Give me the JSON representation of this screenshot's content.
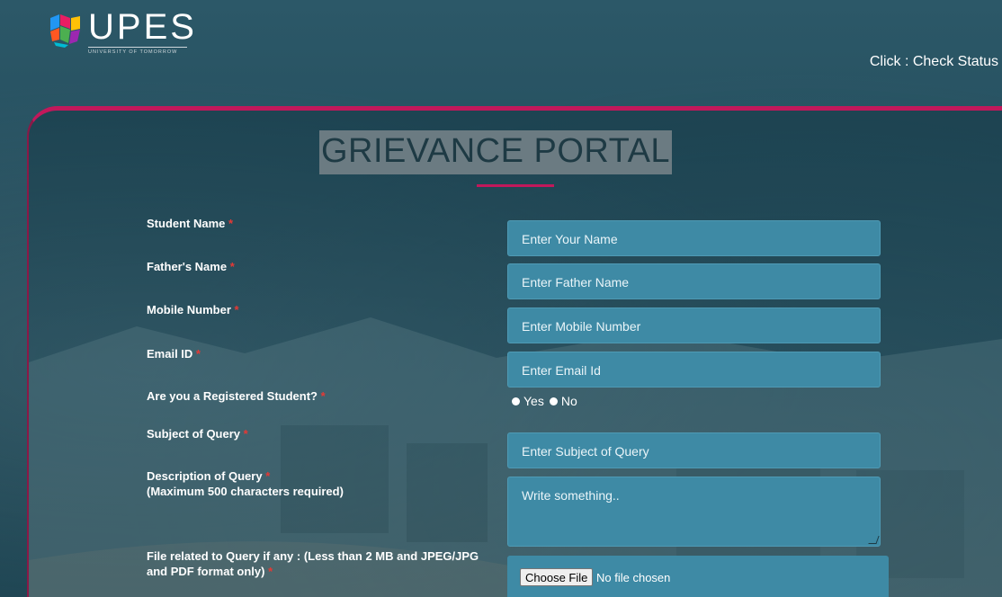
{
  "header": {
    "logo_text": "UPES",
    "logo_tagline": "UNIVERSITY OF TOMORROW",
    "check_status": "Click : Check Status"
  },
  "form": {
    "title": "GRIEVANCE PORTAL",
    "required_marker": "*",
    "fields": {
      "student_name": {
        "label": "Student Name",
        "placeholder": "Enter Your Name"
      },
      "father_name": {
        "label": "Father's Name",
        "placeholder": "Enter Father Name"
      },
      "mobile": {
        "label": "Mobile Number",
        "placeholder": "Enter Mobile Number"
      },
      "email": {
        "label": "Email ID",
        "placeholder": "Enter Email Id"
      },
      "registered": {
        "label": "Are you a Registered Student?",
        "options": [
          "Yes",
          "No"
        ]
      },
      "subject": {
        "label": "Subject of Query",
        "placeholder": "Enter Subject of Query"
      },
      "description": {
        "label": "Description of Query",
        "sublabel": "(Maximum 500 characters required)",
        "placeholder": "Write something.."
      },
      "file": {
        "label_line1": "File related to Query if any : (Less than 2 MB and JPEG/JPG",
        "label_line2": "and PDF format only)",
        "button": "Choose File",
        "status": "No file chosen"
      }
    }
  },
  "colors": {
    "accent": "#c2185b",
    "field_bg": "#3e8aa5",
    "required": "#e53935"
  }
}
